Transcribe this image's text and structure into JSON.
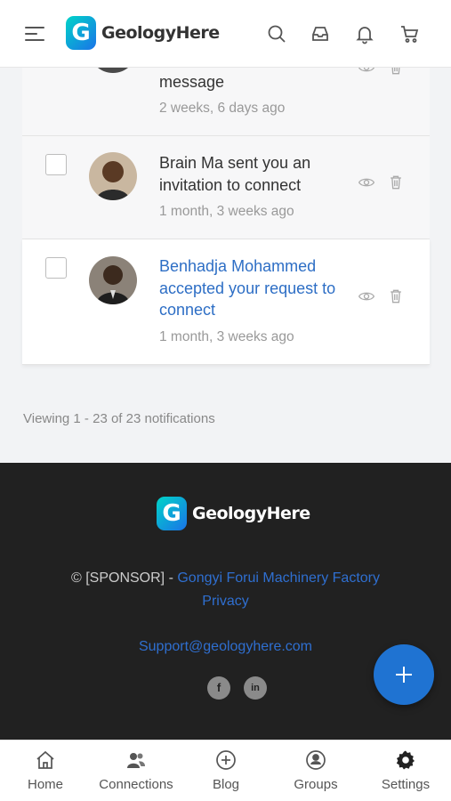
{
  "header": {
    "brand": "GeologyHere"
  },
  "notifications": [
    {
      "text": "message",
      "time": "2 weeks, 6 days ago",
      "link": false
    },
    {
      "text": "Brain Ma sent you an invitation to connect",
      "time": "1 month, 3 weeks ago",
      "link": false
    },
    {
      "text": "Benhadja Mohammed accepted your request to connect",
      "time": "1 month, 3 weeks ago",
      "link": true
    }
  ],
  "viewing": "Viewing 1 - 23 of 23 notifications",
  "footer": {
    "brand": "GeologyHere",
    "copyright_prefix": "© [SPONSOR] -",
    "sponsor_link": "Gongyi Forui Machinery Factory",
    "privacy": "Privacy",
    "support": "Support@geologyhere.com",
    "social": [
      "f",
      "in"
    ]
  },
  "bottom_nav": [
    {
      "label": "Home",
      "icon": "home-icon"
    },
    {
      "label": "Connections",
      "icon": "connections-icon"
    },
    {
      "label": "Blog",
      "icon": "plus-circle-icon"
    },
    {
      "label": "Groups",
      "icon": "groups-icon"
    },
    {
      "label": "Settings",
      "icon": "gear-icon"
    }
  ],
  "colors": {
    "accent": "#1f73d2",
    "link": "#2d6ec5",
    "footer_bg": "#212121"
  }
}
